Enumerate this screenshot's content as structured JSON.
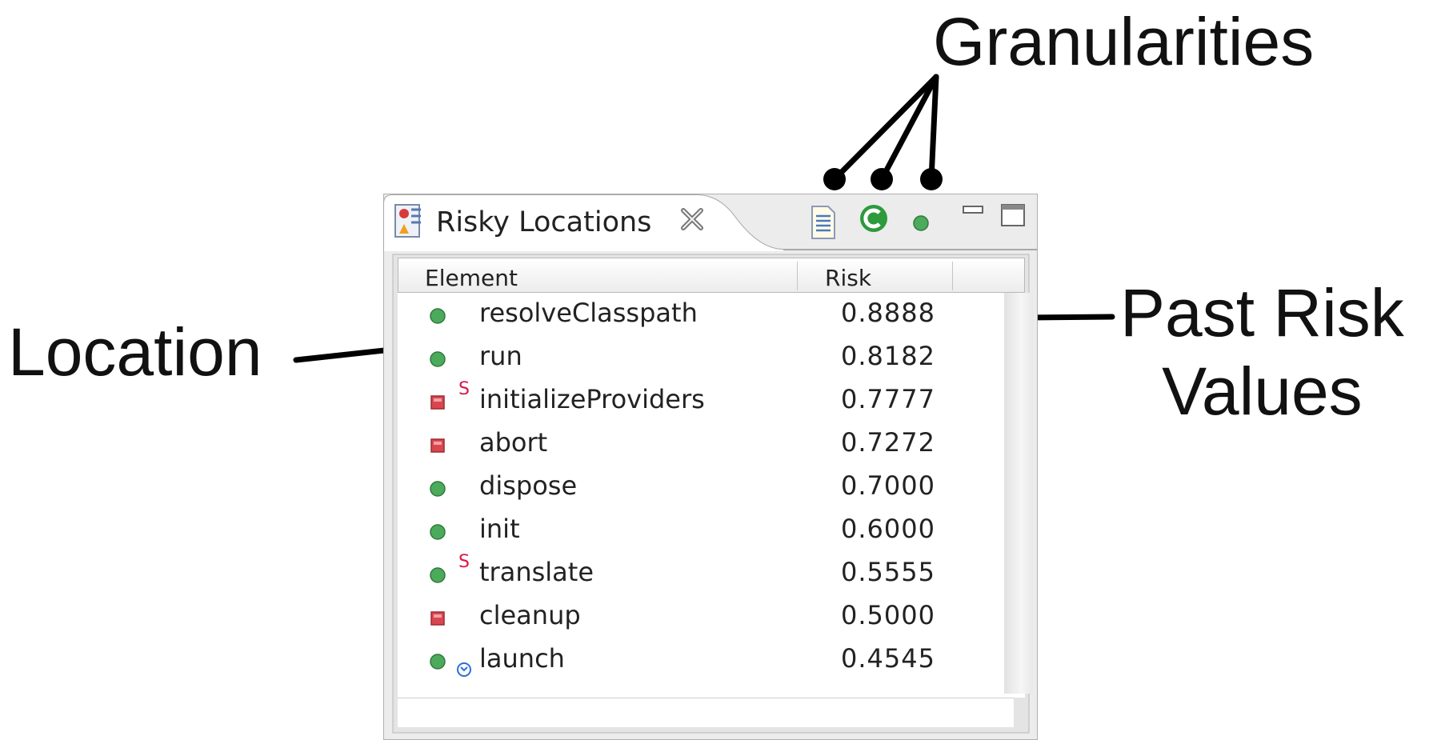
{
  "callouts": {
    "granularities": "Granularities",
    "location": "Location",
    "past_risk_line1": "Past Risk",
    "past_risk_line2": "Values"
  },
  "view": {
    "title": "Risky Locations",
    "toolbar": [
      "file-granularity-icon",
      "class-granularity-icon",
      "method-granularity-icon",
      "minimize-icon",
      "maximize-icon"
    ],
    "columns": {
      "element": "Element",
      "risk": "Risk"
    },
    "rows": [
      {
        "name": "resolveClasspath",
        "risk": "0.8888",
        "kind": "public-method",
        "modifier": ""
      },
      {
        "name": "run",
        "risk": "0.8182",
        "kind": "public-method",
        "modifier": ""
      },
      {
        "name": "initializeProviders",
        "risk": "0.7777",
        "kind": "private-method",
        "modifier": "S"
      },
      {
        "name": "abort",
        "risk": "0.7272",
        "kind": "private-method",
        "modifier": ""
      },
      {
        "name": "dispose",
        "risk": "0.7000",
        "kind": "public-method",
        "modifier": ""
      },
      {
        "name": "init",
        "risk": "0.6000",
        "kind": "public-method",
        "modifier": ""
      },
      {
        "name": "translate",
        "risk": "0.5555",
        "kind": "public-method",
        "modifier": "S"
      },
      {
        "name": "cleanup",
        "risk": "0.5000",
        "kind": "private-method",
        "modifier": ""
      },
      {
        "name": "launch",
        "risk": "0.4545",
        "kind": "public-method",
        "modifier": "synchronized-icon"
      }
    ],
    "colors": {
      "public": "#4caa5c",
      "private": "#d8474f",
      "modifier": "#d81848",
      "sync": "#2a6fd6"
    }
  }
}
